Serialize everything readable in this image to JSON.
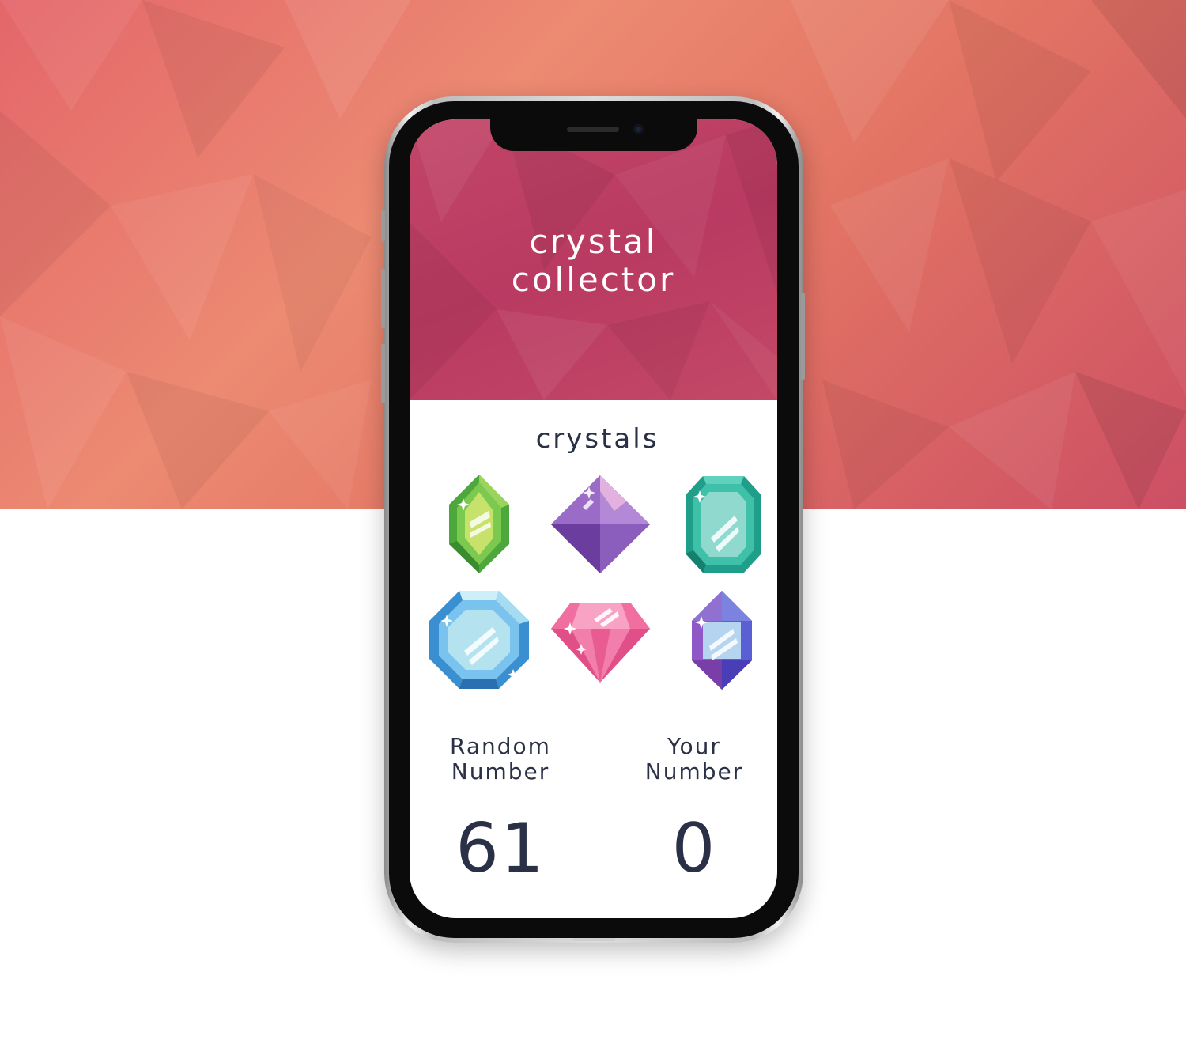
{
  "app": {
    "title_line1": "crystal",
    "title_line2": "collector"
  },
  "crystals": {
    "heading": "crystals",
    "items": [
      {
        "name": "green-crystal",
        "color": "#6cc04a"
      },
      {
        "name": "purple-crystal",
        "color": "#8a5fb5"
      },
      {
        "name": "teal-crystal",
        "color": "#3cbfa7"
      },
      {
        "name": "blue-crystal",
        "color": "#5fb8e6"
      },
      {
        "name": "pink-crystal",
        "color": "#ec6a9c"
      },
      {
        "name": "violet-crystal",
        "color": "#7050c0"
      }
    ]
  },
  "stats": {
    "random_label_line1": "Random",
    "random_label_line2": "Number",
    "random_value": "61",
    "your_label_line1": "Your",
    "your_label_line2": "Number",
    "your_value": "0"
  },
  "colors": {
    "banner": "#e4726a",
    "header": "#bd4064",
    "text_dark": "#2a3147"
  }
}
